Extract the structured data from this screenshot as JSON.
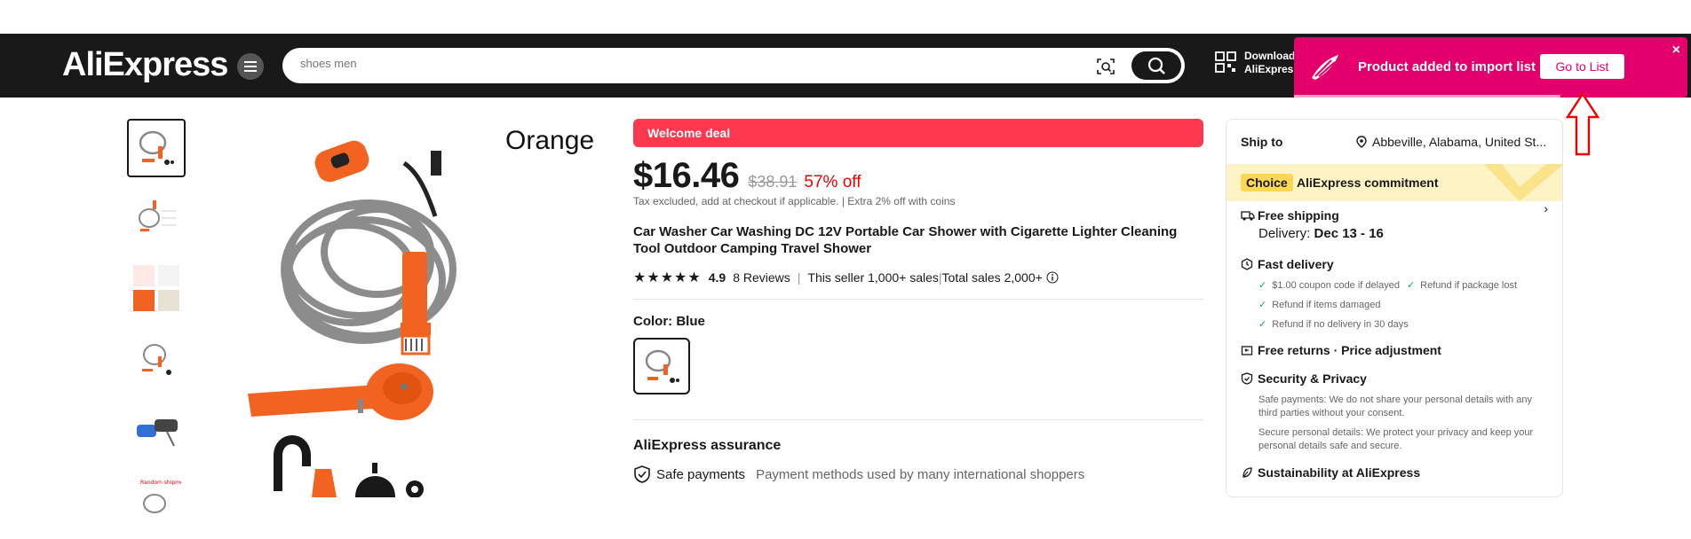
{
  "header": {
    "logo": "AliExpress",
    "search_placeholder": "shoes men",
    "download_line1": "Download",
    "download_line2": "AliExpress"
  },
  "toast": {
    "message": "Product added to import list",
    "button": "Go to List",
    "close": "×"
  },
  "gallery": {
    "main_label": "Orange"
  },
  "product": {
    "deal_badge": "Welcome deal",
    "price": "$16.46",
    "original_price": "$38.91",
    "discount": "57% off",
    "tax_note": "Tax excluded, add at checkout if applicable.",
    "coins_note": "Extra 2% off with coins",
    "title": "Car Washer Car Washing DC 12V Portable Car Shower with Cigarette Lighter Cleaning Tool Outdoor Camping Travel Shower",
    "rating": "4.9",
    "reviews": "8 Reviews",
    "seller_sales": "This seller 1,000+ sales",
    "total_sales": "Total sales 2,000+",
    "color_label": "Color: ",
    "color_value": "Blue",
    "assurance_title": "AliExpress assurance",
    "safe_payments": "Safe payments",
    "safe_payments_desc": "Payment methods used by many international shoppers"
  },
  "side": {
    "ship_to_label": "Ship to",
    "ship_location": "Abbeville, Alabama, United St...",
    "choice_badge": "Choice",
    "commitment": "AliExpress commitment",
    "free_shipping": "Free shipping",
    "delivery_label": "Delivery: ",
    "delivery_dates": "Dec 13 - 16",
    "fast_delivery": "Fast delivery",
    "coupon": "$1.00 coupon code if delayed",
    "refund_lost": "Refund if package lost",
    "refund_damaged": "Refund if items damaged",
    "refund_no_delivery": "Refund if no delivery in 30 days",
    "free_returns": "Free returns · Price adjustment",
    "security": "Security & Privacy",
    "safe_pay_text": "Safe payments: We do not share your personal details with any third parties without your consent.",
    "secure_details_text": "Secure personal details: We protect your privacy and keep your personal details safe and secure.",
    "sustainability": "Sustainability at AliExpress"
  },
  "colors": {
    "header_bg": "#191919",
    "toast_bg": "#e3006c",
    "deal_red": "#fd384f",
    "discount_red": "#ee0000",
    "choice_yellow": "#fad754"
  }
}
